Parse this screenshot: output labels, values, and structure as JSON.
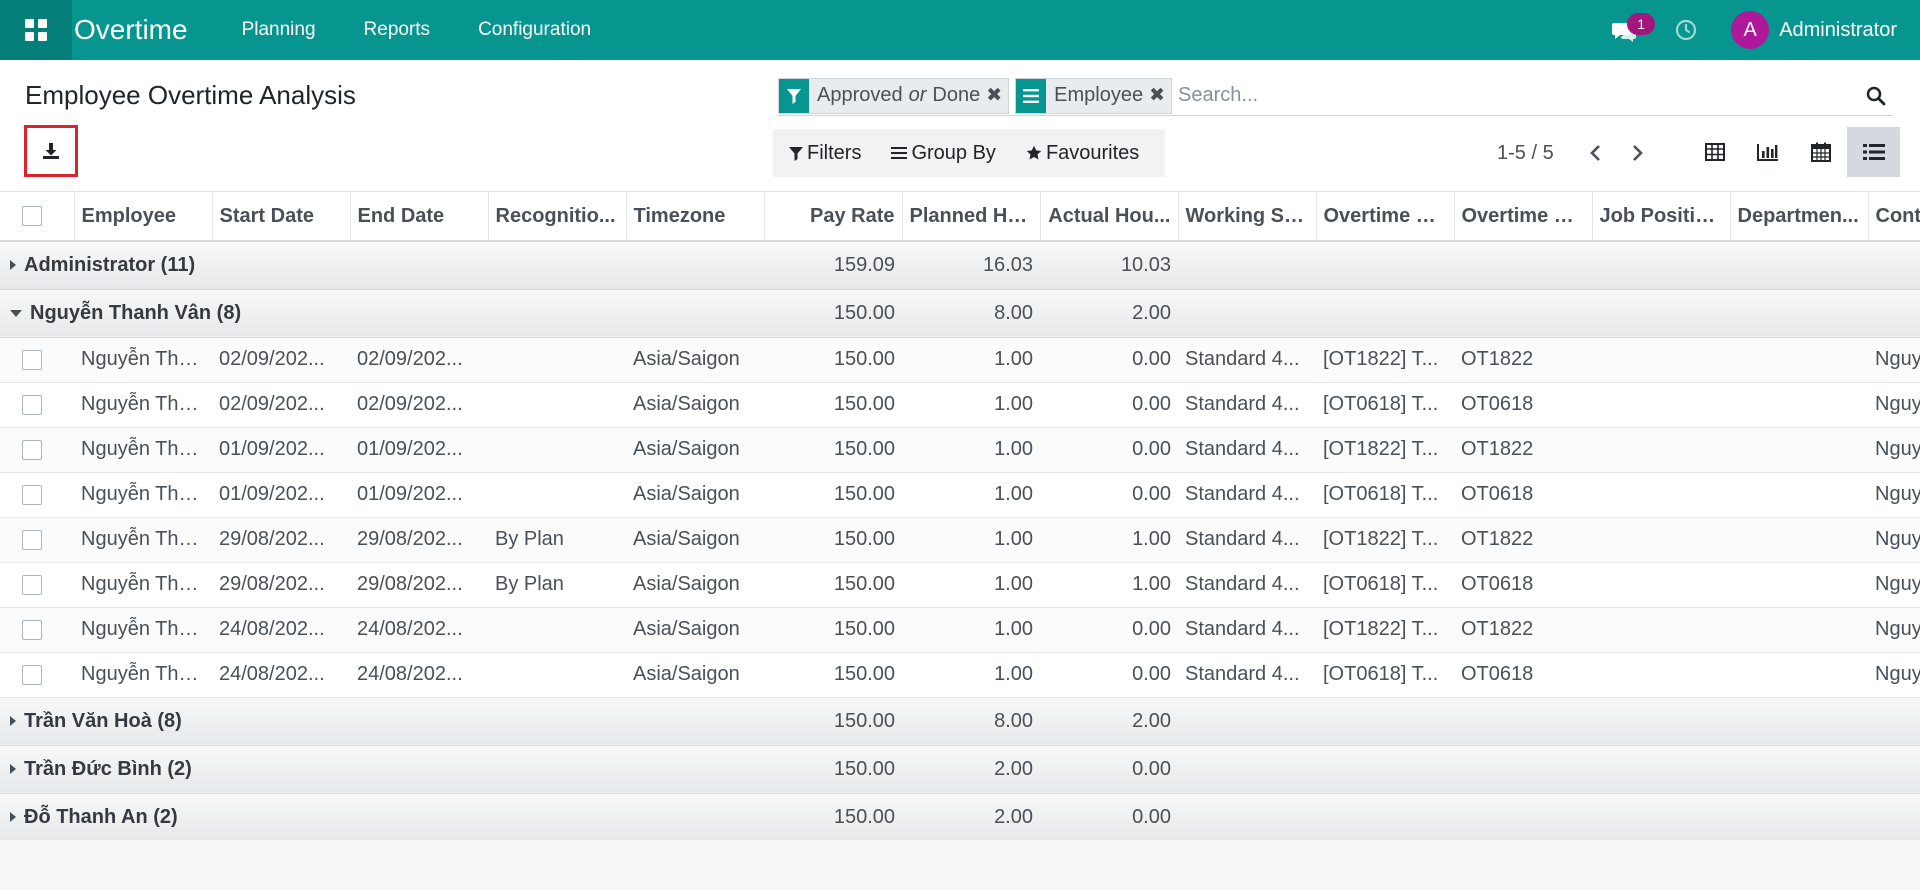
{
  "app": {
    "title": "Overtime",
    "menu": [
      "Planning",
      "Reports",
      "Configuration"
    ],
    "notification_count": "1",
    "user_initial": "A",
    "user_name": "Administrator"
  },
  "page": {
    "title": "Employee Overtime Analysis"
  },
  "search": {
    "facets": [
      {
        "icon": "filter-icon",
        "values": [
          "Approved",
          "Done"
        ],
        "separator": "or"
      },
      {
        "icon": "group-by-icon",
        "values": [
          "Employee"
        ]
      }
    ],
    "placeholder": "Search..."
  },
  "filters": {
    "filters_label": "Filters",
    "group_by_label": "Group By",
    "favourites_label": "Favourites"
  },
  "pager": {
    "value": "1-5 / 5"
  },
  "views": [
    "pivot-view-icon",
    "graph-view-icon",
    "calendar-view-icon",
    "list-view-icon"
  ],
  "active_view": "list-view-icon",
  "colors": {
    "navbar": "#06958f",
    "badge": "#a3177c",
    "avatar": "#b0189a",
    "highlight_border": "#d9232e"
  },
  "table": {
    "columns": [
      "Employee",
      "Start Date",
      "End Date",
      "Recognitio...",
      "Timezone",
      "Pay Rate",
      "Planned Ho...",
      "Actual Hou...",
      "Working Sc...",
      "Overtime R...",
      "Overtime R...",
      "Job Positio...",
      "Departmen...",
      "Contra"
    ],
    "groups": [
      {
        "label": "Administrator (11)",
        "expanded": false,
        "pay_rate": "159.09",
        "planned": "16.03",
        "actual": "10.03",
        "rows": []
      },
      {
        "label": "Nguyễn Thanh Vân (8)",
        "expanded": true,
        "pay_rate": "150.00",
        "planned": "8.00",
        "actual": "2.00",
        "rows": [
          {
            "employee": "Nguyễn Tha...",
            "start": "02/09/202...",
            "end": "02/09/202...",
            "recognition": "",
            "timezone": "Asia/Saigon",
            "pay_rate": "150.00",
            "planned": "1.00",
            "actual": "0.00",
            "schedule": "Standard 4...",
            "ot_rule": "[OT1822] T...",
            "ot_code": "OT1822",
            "job": "",
            "department": "",
            "contract": "Nguyễ"
          },
          {
            "employee": "Nguyễn Tha...",
            "start": "02/09/202...",
            "end": "02/09/202...",
            "recognition": "",
            "timezone": "Asia/Saigon",
            "pay_rate": "150.00",
            "planned": "1.00",
            "actual": "0.00",
            "schedule": "Standard 4...",
            "ot_rule": "[OT0618] T...",
            "ot_code": "OT0618",
            "job": "",
            "department": "",
            "contract": "Nguyễ"
          },
          {
            "employee": "Nguyễn Tha...",
            "start": "01/09/202...",
            "end": "01/09/202...",
            "recognition": "",
            "timezone": "Asia/Saigon",
            "pay_rate": "150.00",
            "planned": "1.00",
            "actual": "0.00",
            "schedule": "Standard 4...",
            "ot_rule": "[OT1822] T...",
            "ot_code": "OT1822",
            "job": "",
            "department": "",
            "contract": "Nguyễ"
          },
          {
            "employee": "Nguyễn Tha...",
            "start": "01/09/202...",
            "end": "01/09/202...",
            "recognition": "",
            "timezone": "Asia/Saigon",
            "pay_rate": "150.00",
            "planned": "1.00",
            "actual": "0.00",
            "schedule": "Standard 4...",
            "ot_rule": "[OT0618] T...",
            "ot_code": "OT0618",
            "job": "",
            "department": "",
            "contract": "Nguyễ"
          },
          {
            "employee": "Nguyễn Tha...",
            "start": "29/08/202...",
            "end": "29/08/202...",
            "recognition": "By Plan",
            "timezone": "Asia/Saigon",
            "pay_rate": "150.00",
            "planned": "1.00",
            "actual": "1.00",
            "schedule": "Standard 4...",
            "ot_rule": "[OT1822] T...",
            "ot_code": "OT1822",
            "job": "",
            "department": "",
            "contract": "Nguyễ"
          },
          {
            "employee": "Nguyễn Tha...",
            "start": "29/08/202...",
            "end": "29/08/202...",
            "recognition": "By Plan",
            "timezone": "Asia/Saigon",
            "pay_rate": "150.00",
            "planned": "1.00",
            "actual": "1.00",
            "schedule": "Standard 4...",
            "ot_rule": "[OT0618] T...",
            "ot_code": "OT0618",
            "job": "",
            "department": "",
            "contract": "Nguyễ"
          },
          {
            "employee": "Nguyễn Tha...",
            "start": "24/08/202...",
            "end": "24/08/202...",
            "recognition": "",
            "timezone": "Asia/Saigon",
            "pay_rate": "150.00",
            "planned": "1.00",
            "actual": "0.00",
            "schedule": "Standard 4...",
            "ot_rule": "[OT1822] T...",
            "ot_code": "OT1822",
            "job": "",
            "department": "",
            "contract": "Nguyễ"
          },
          {
            "employee": "Nguyễn Tha...",
            "start": "24/08/202...",
            "end": "24/08/202...",
            "recognition": "",
            "timezone": "Asia/Saigon",
            "pay_rate": "150.00",
            "planned": "1.00",
            "actual": "0.00",
            "schedule": "Standard 4...",
            "ot_rule": "[OT0618] T...",
            "ot_code": "OT0618",
            "job": "",
            "department": "",
            "contract": "Nguyễ"
          }
        ]
      },
      {
        "label": "Trần Văn Hoà (8)",
        "expanded": false,
        "pay_rate": "150.00",
        "planned": "8.00",
        "actual": "2.00",
        "rows": []
      },
      {
        "label": "Trần Đức Bình (2)",
        "expanded": false,
        "pay_rate": "150.00",
        "planned": "2.00",
        "actual": "0.00",
        "rows": []
      },
      {
        "label": "Đỗ Thanh An (2)",
        "expanded": false,
        "pay_rate": "150.00",
        "planned": "2.00",
        "actual": "0.00",
        "rows": []
      }
    ]
  }
}
